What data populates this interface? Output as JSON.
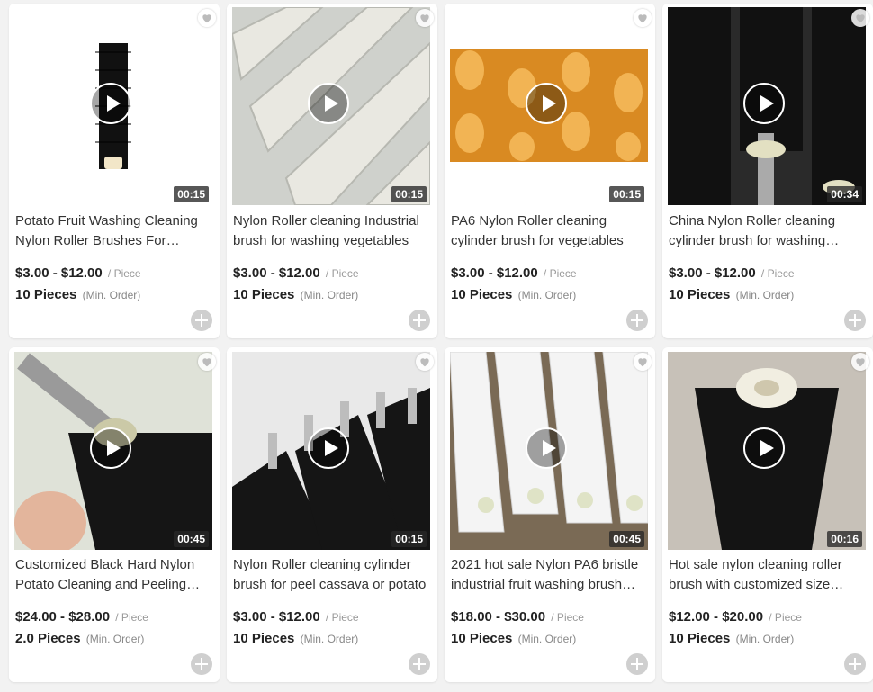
{
  "products": [
    {
      "title": "Potato Fruit Washing Cleaning Nylon Roller Brushes For Vegetable",
      "price": "$3.00 - $12.00",
      "unit": "/ Piece",
      "moq": "10 Pieces",
      "moq_note": "(Min. Order)",
      "duration": "00:15",
      "image": "black-brush-isolated"
    },
    {
      "title": "Nylon Roller cleaning Industrial brush for washing vegetables",
      "price": "$3.00 - $12.00",
      "unit": "/ Piece",
      "moq": "10 Pieces",
      "moq_note": "(Min. Order)",
      "duration": "00:15",
      "image": "white-bristle-rollers"
    },
    {
      "title": "PA6 Nylon Roller cleaning cylinder brush for vegetables",
      "price": "$3.00 - $12.00",
      "unit": "/ Piece",
      "moq": "10 Pieces",
      "moq_note": "(Min. Order)",
      "duration": "00:15",
      "image": "orange-spiral-brushes"
    },
    {
      "title": "China Nylon Roller cleaning cylinder brush for washing machine",
      "price": "$3.00 - $12.00",
      "unit": "/ Piece",
      "moq": "10 Pieces",
      "moq_note": "(Min. Order)",
      "duration": "00:34",
      "image": "black-rollers-shaft"
    },
    {
      "title": "Customized Black Hard Nylon Potato Cleaning and Peeling Brush",
      "price": "$24.00 - $28.00",
      "unit": "/ Piece",
      "moq": "2.0 Pieces",
      "moq_note": "(Min. Order)",
      "duration": "00:45",
      "image": "hand-holding-brush"
    },
    {
      "title": "Nylon Roller cleaning cylinder brush for peel cassava or potato",
      "price": "$3.00 - $12.00",
      "unit": "/ Piece",
      "moq": "10 Pieces",
      "moq_note": "(Min. Order)",
      "duration": "00:15",
      "image": "black-rollers-row"
    },
    {
      "title": "2021 hot sale Nylon PA6 bristle industrial fruit washing brush roller",
      "price": "$18.00 - $30.00",
      "unit": "/ Piece",
      "moq": "10 Pieces",
      "moq_note": "(Min. Order)",
      "duration": "00:45",
      "image": "white-rollers-stack"
    },
    {
      "title": "Hot sale nylon cleaning roller brush with customized size available",
      "price": "$12.00 - $20.00",
      "unit": "/ Piece",
      "moq": "10 Pieces",
      "moq_note": "(Min. Order)",
      "duration": "00:16",
      "image": "black-brush-white-core"
    }
  ],
  "icons": {
    "favorite": "heart-icon",
    "play": "play-icon",
    "add": "plus-icon"
  },
  "colors": {
    "price": "#222222",
    "muted": "#999999",
    "badge_bg": "#3c3c3c",
    "add_btn": "#cfcfcf"
  }
}
